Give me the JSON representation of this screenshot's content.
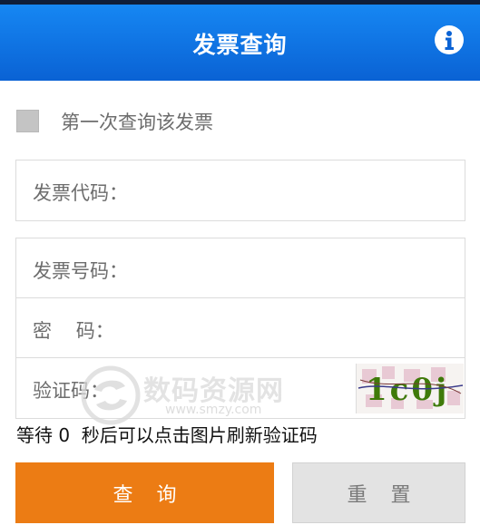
{
  "app_bar": {
    "title": "发票查询",
    "info_icon": "info-icon"
  },
  "first_query": {
    "label": "第一次查询该发票",
    "checked": false
  },
  "fields": {
    "invoice_code": {
      "label": "发票代码：",
      "value": ""
    },
    "invoice_number": {
      "label": "发票号码：",
      "value": ""
    },
    "password": {
      "label": "密    码：",
      "value": ""
    },
    "captcha": {
      "label": "验证码：",
      "value": "",
      "image_text": "1c0j"
    }
  },
  "hint": "等待 0  秒后可以点击图片刷新验证码",
  "buttons": {
    "query": "查询",
    "reset": "重置"
  },
  "watermark": {
    "text": "数码资源网",
    "url": "www.smzy.com"
  },
  "colors": {
    "app_bar": "#0a62d4",
    "query_button": "#ec7c14",
    "reset_button": "#e3e3e3",
    "captcha_text": "#3f7a0a"
  }
}
